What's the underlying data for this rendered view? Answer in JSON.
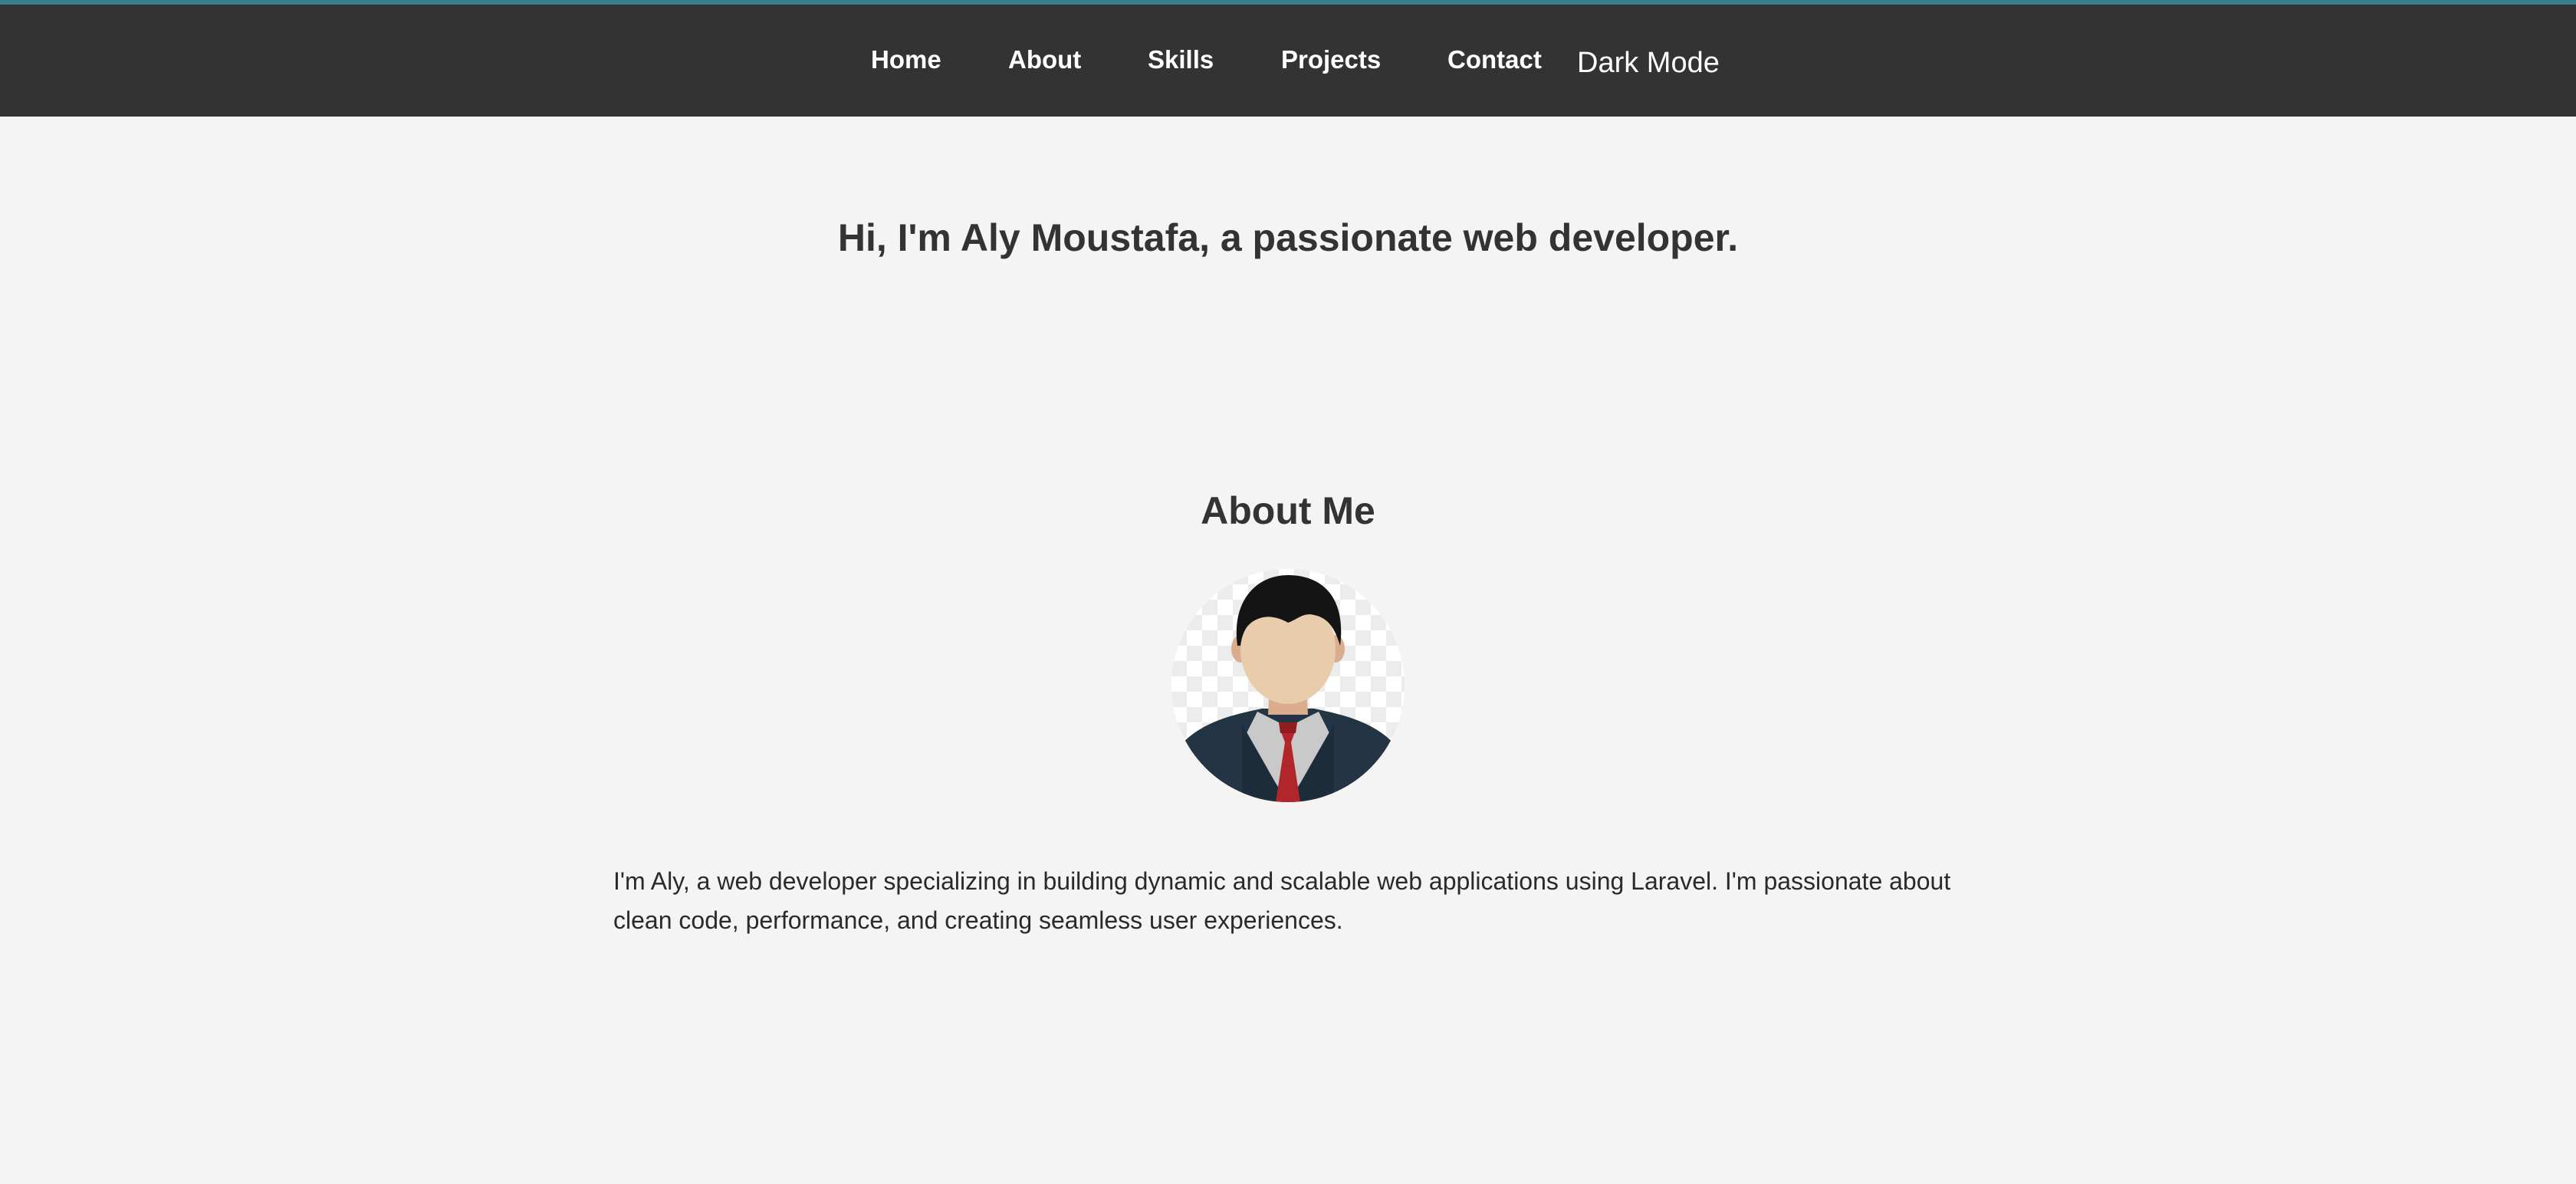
{
  "nav": {
    "items": [
      {
        "label": "Home"
      },
      {
        "label": "About"
      },
      {
        "label": "Skills"
      },
      {
        "label": "Projects"
      },
      {
        "label": "Contact"
      }
    ],
    "dark_mode_label": "Dark Mode"
  },
  "hero": {
    "title": "Hi, I'm Aly Moustafa, a passionate web developer."
  },
  "about": {
    "title": "About Me",
    "avatar_icon": "person-avatar-icon",
    "text": "I'm Aly, a web developer specializing in building dynamic and scalable web applications using Laravel. I'm passionate about clean code, performance, and creating seamless user experiences."
  },
  "colors": {
    "nav_background": "#333333",
    "page_background": "#f4f4f4",
    "text": "#333333",
    "accent_line": "#3b7d8c"
  }
}
